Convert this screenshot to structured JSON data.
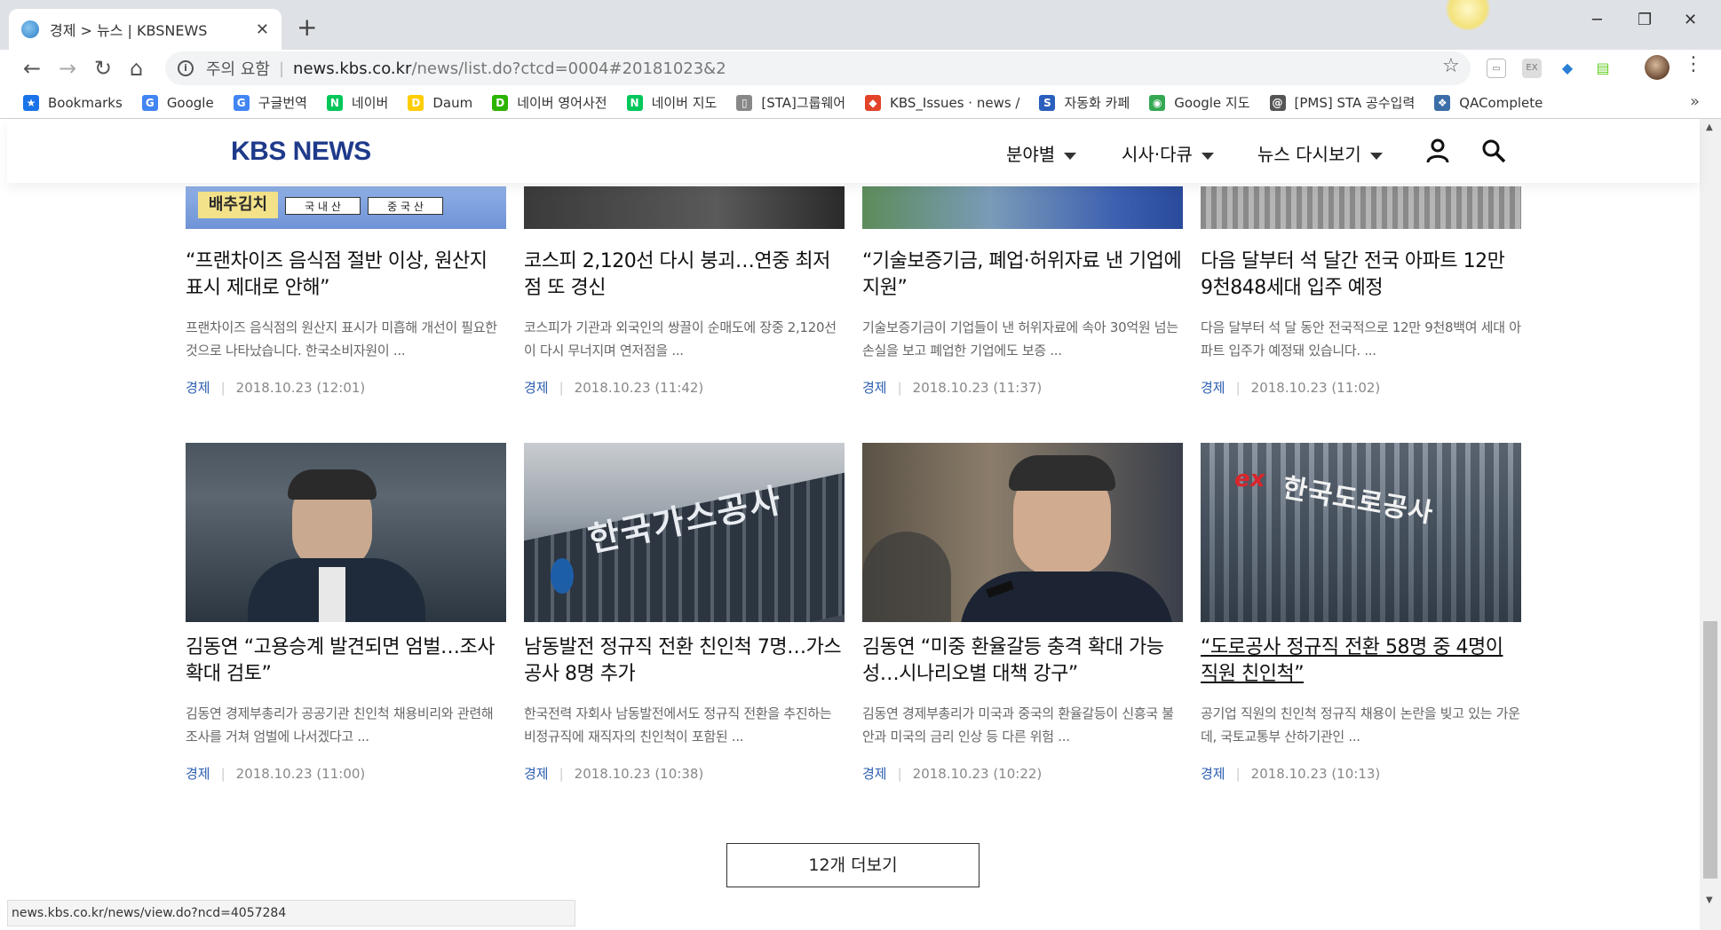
{
  "browser": {
    "tab_title": "경제 > 뉴스 | KBSNEWS",
    "tab_close": "✕",
    "new_tab": "+",
    "url_warning": "주의 요함",
    "url_host": "news.kbs.co.kr",
    "url_path": "/news/list.do?ctcd=0004#20181023&2",
    "bookmarks": [
      {
        "label": "Bookmarks",
        "icon": "star-icon",
        "color": "#1a73e8"
      },
      {
        "label": "Google",
        "icon": "google-icon",
        "color": "#4285f4"
      },
      {
        "label": "구글번역",
        "icon": "translate-icon",
        "color": "#4285f4"
      },
      {
        "label": "네이버",
        "icon": "naver-icon",
        "color": "#03c75a"
      },
      {
        "label": "Daum",
        "icon": "daum-icon",
        "color": "#ffcd00"
      },
      {
        "label": "네이버 영어사전",
        "icon": "dict-icon",
        "color": "#2db400"
      },
      {
        "label": "네이버 지도",
        "icon": "naver-icon",
        "color": "#03c75a"
      },
      {
        "label": "[STA]그룹웨어",
        "icon": "page-icon",
        "color": "#888888"
      },
      {
        "label": "KBS_Issues · news /",
        "icon": "gitlab-icon",
        "color": "#e24329"
      },
      {
        "label": "자동화 카페",
        "icon": "sta-icon",
        "color": "#2b5fbd"
      },
      {
        "label": "Google 지도",
        "icon": "maps-icon",
        "color": "#34a853"
      },
      {
        "label": "[PMS] STA 공수입력",
        "icon": "pms-icon",
        "color": "#555555"
      },
      {
        "label": "QAComplete",
        "icon": "qa-icon",
        "color": "#3b6ea8"
      }
    ],
    "bookmarks_more": "»",
    "status_url": "news.kbs.co.kr/news/view.do?ncd=4057284"
  },
  "site": {
    "logo": "KBS NEWS",
    "nav": [
      {
        "label": "분야별"
      },
      {
        "label": "시사·다큐"
      },
      {
        "label": "뉴스 다시보기"
      }
    ]
  },
  "top_row": [
    {
      "headline": "“프랜차이즈 음식점 절반 이상, 원산지 표시 제대로 안해”",
      "summary": "프랜차이즈 음식점의 원산지 표시가 미흡해 개선이 필요한 것으로 나타났습니다. 한국소비자원이 ...",
      "category": "경제",
      "date": "2018.10.23 (12:01)",
      "thumb_text": [
        "배추김치",
        "국 내 산",
        "중 국 산"
      ]
    },
    {
      "headline": "코스피 2,120선 다시 붕괴…연중 최저점 또 경신",
      "summary": "코스피가 기관과 외국인의 쌍끌이 순매도에 장중 2,120선이 다시 무너지며 연저점을 ...",
      "category": "경제",
      "date": "2018.10.23 (11:42)"
    },
    {
      "headline": "“기술보증기금, 폐업·허위자료 낸 기업에 지원”",
      "summary": "기술보증기금이 기업들이 낸 허위자료에 속아 30억원 넘는 손실을 보고 폐업한 기업에도 보증 ...",
      "category": "경제",
      "date": "2018.10.23 (11:37)"
    },
    {
      "headline": "다음 달부터 석 달간 전국 아파트 12만 9천848세대 입주 예정",
      "summary": "다음 달부터 석 달 동안 전국적으로 12만 9천8백여 세대 아파트 입주가 예정돼 있습니다. ...",
      "category": "경제",
      "date": "2018.10.23 (11:02)"
    }
  ],
  "bottom_row": [
    {
      "headline": "김동연 “고용승계 발견되면 엄벌…조사 확대 검토”",
      "summary": "김동연 경제부총리가 공공기관 친인척 채용비리와 관련해 조사를 거쳐 엄벌에 나서겠다고 ...",
      "category": "경제",
      "date": "2018.10.23 (11:00)"
    },
    {
      "headline": "남동발전 정규직 전환 친인척 7명…가스공사 8명 추가",
      "summary": "한국전력 자회사 남동발전에서도 정규직 전환을 추진하는 비정규직에 재직자의 친인척이 포함된 ...",
      "category": "경제",
      "date": "2018.10.23 (10:38)",
      "thumb_text": "한국가스공사"
    },
    {
      "headline": "김동연 “미중 환율갈등 충격 확대 가능성…시나리오별 대책 강구”",
      "summary": "김동연 경제부총리가 미국과 중국의 환율갈등이 신흥국 불안과 미국의 금리 인상 등 다른 위험 ...",
      "category": "경제",
      "date": "2018.10.23 (10:22)"
    },
    {
      "headline": "“도로공사 정규직 전환 58명 중 4명이 직원 친인척”",
      "summary": "공기업 직원의 친인척 정규직 채용이 논란을 빚고 있는 가운데, 국토교통부 산하기관인 ...",
      "category": "경제",
      "date": "2018.10.23 (10:13)",
      "thumb_text": "한국도로공사",
      "thumb_logo": "ex"
    }
  ],
  "more_button": "12개 더보기",
  "colors": {
    "accent": "#1e3a8a",
    "category": "#2d5fb1"
  }
}
